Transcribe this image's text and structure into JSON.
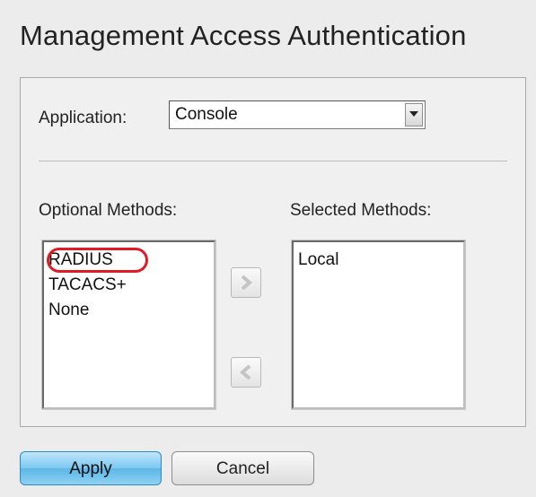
{
  "page": {
    "title": "Management Access Authentication"
  },
  "application": {
    "label": "Application:",
    "selected": "Console"
  },
  "optional_methods": {
    "label": "Optional Methods:",
    "items": [
      "RADIUS",
      "TACACS+",
      "None"
    ]
  },
  "selected_methods": {
    "label": "Selected Methods:",
    "items": [
      "Local"
    ]
  },
  "buttons": {
    "apply_label": "Apply",
    "cancel_label": "Cancel"
  },
  "icons": {
    "dropdown": "chevron-down-icon",
    "add": "chevron-right-icon",
    "remove": "chevron-left-icon"
  },
  "colors": {
    "highlight_ring": "#e01b24",
    "apply_button": "#7cc7ef"
  }
}
